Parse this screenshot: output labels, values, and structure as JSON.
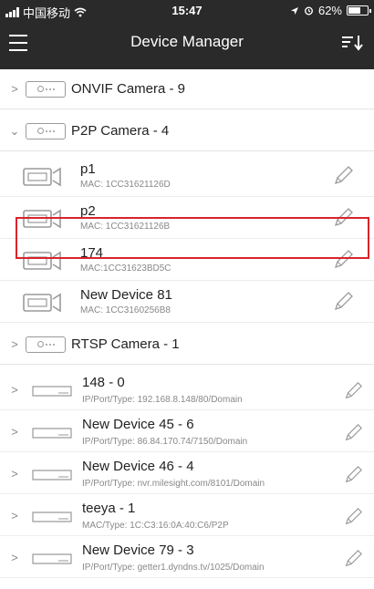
{
  "status": {
    "carrier": "中国移动",
    "time": "15:47",
    "battery": "62%"
  },
  "nav": {
    "title": "Device Manager"
  },
  "groups": {
    "onvif": "ONVIF Camera - 9",
    "p2p": "P2P Camera - 4",
    "rtsp": "RTSP Camera - 1"
  },
  "p2p_devices": [
    {
      "name": "p1",
      "mac": "MAC: 1CC31621126D"
    },
    {
      "name": "p2",
      "mac": "MAC: 1CC31621126B"
    },
    {
      "name": "174",
      "mac": "MAC:1CC31623BD5C"
    },
    {
      "name": "New Device 81",
      "mac": "MAC: 1CC3160256B8"
    }
  ],
  "recorders": [
    {
      "name": "148 - 0",
      "meta": "IP/Port/Type: 192.168.8.148/80/Domain"
    },
    {
      "name": "New Device 45 - 6",
      "meta": "IP/Port/Type: 86.84.170.74/7150/Domain"
    },
    {
      "name": "New Device 46 - 4",
      "meta": "IP/Port/Type: nvr.milesight.com/8101/Domain"
    },
    {
      "name": "teeya - 1",
      "meta": "MAC/Type: 1C:C3:16:0A:40:C6/P2P"
    },
    {
      "name": "New Device 79 - 3",
      "meta": "IP/Port/Type: getter1.dyndns.tv/1025/Domain"
    }
  ],
  "icons": {
    "menu": "hamburger-menu-icon",
    "sort": "sort-down-icon",
    "edit": "pencil-icon",
    "camera": "camera-icon",
    "recorder": "nvr-icon"
  },
  "colors": {
    "topbar": "#2a2a2a",
    "highlight": "#d9242b"
  }
}
